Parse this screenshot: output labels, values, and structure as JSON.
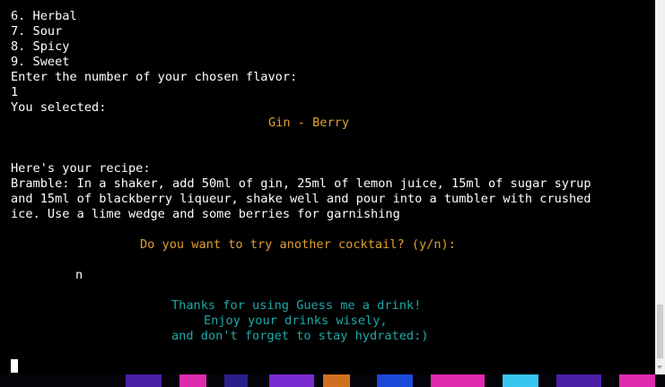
{
  "terminal": {
    "menu": [
      "6. Herbal",
      "7. Sour",
      "8. Spicy",
      "9. Sweet"
    ],
    "prompt_flavor": "Enter the number of your chosen flavor:",
    "input_flavor": "1",
    "selected_label": "You selected:",
    "selected_value": "Gin - Berry",
    "recipe_header": "Here's your recipe:",
    "recipe_lines": [
      "Bramble: In a shaker, add 50ml of gin, 25ml of lemon juice, 15ml of sugar syrup",
      "and 15ml of blackberry liqueur, shake well and pour into a tumbler with crushed",
      "ice. Use a lime wedge and some berries for garnishing"
    ],
    "retry_prompt": "Do you want to try another cocktail? (y/n):",
    "retry_input": "n",
    "farewell": [
      "Thanks for using Guess me a drink!",
      "Enjoy your drinks wisely,",
      "and don't forget to stay hydrated:)"
    ]
  },
  "colors": {
    "background": "#000000",
    "text": "#ffffff",
    "highlight": "#e0a030",
    "farewell": "#1fa8a8"
  }
}
